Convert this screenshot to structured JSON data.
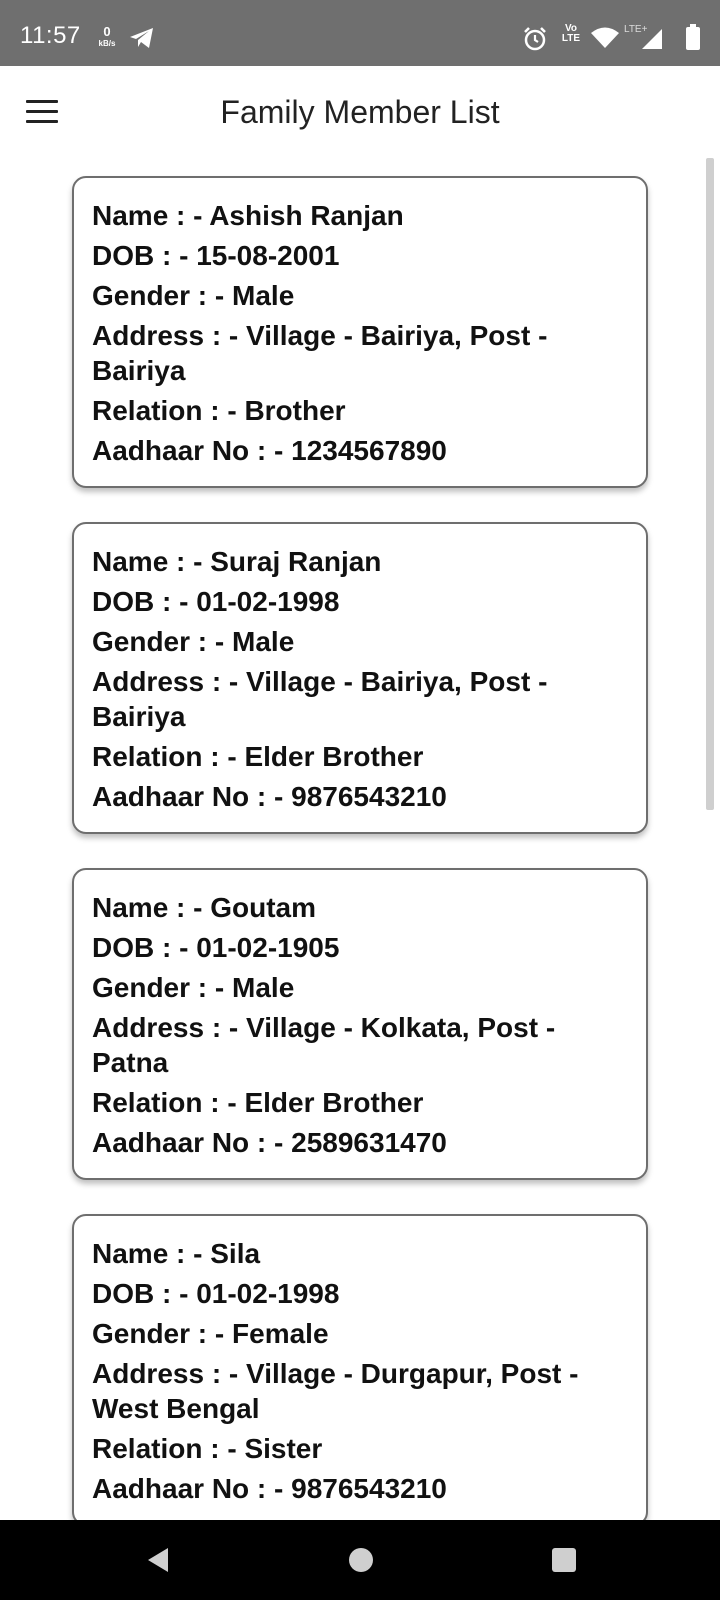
{
  "status_bar": {
    "time": "11:57",
    "speed_value": "0",
    "speed_unit": "kB/s",
    "volte_top": "Vo",
    "volte_bottom": "LTE",
    "lte_label": "LTE+",
    "icons": [
      "telegram-icon",
      "alarm-icon",
      "volte-icon",
      "wifi-icon",
      "signal-icon",
      "battery-icon"
    ]
  },
  "app_bar": {
    "title": "Family Member List",
    "menu_icon": "hamburger-menu-icon"
  },
  "members": [
    {
      "name": "Name : - Ashish Ranjan",
      "dob": "DOB : - 15-08-2001",
      "gender": "Gender : - Male",
      "address": "Address : - Village - Bairiya, Post - Bairiya",
      "relation": "Relation : - Brother",
      "aadhaar": "Aadhaar No : - 1234567890"
    },
    {
      "name": "Name : - Suraj Ranjan",
      "dob": "DOB : - 01-02-1998",
      "gender": "Gender : - Male",
      "address": "Address : - Village - Bairiya, Post - Bairiya",
      "relation": "Relation : - Elder Brother",
      "aadhaar": "Aadhaar No : - 9876543210"
    },
    {
      "name": "Name : - Goutam",
      "dob": "DOB : - 01-02-1905",
      "gender": "Gender : - Male",
      "address": "Address : - Village - Kolkata, Post - Patna",
      "relation": "Relation : - Elder Brother",
      "aadhaar": "Aadhaar No : - 2589631470"
    },
    {
      "name": "Name : - Sila",
      "dob": "DOB : - 01-02-1998",
      "gender": "Gender : - Female",
      "address": "Address : - Village - Durgapur, Post - West Bengal",
      "relation": "Relation : - Sister",
      "aadhaar": "Aadhaar No : - 9876543210"
    }
  ],
  "nav_bar": {
    "icons": [
      "back-icon",
      "home-icon",
      "recents-icon"
    ]
  },
  "colors": {
    "status_bar_bg": "#6f6f6f",
    "card_border": "#6e6e6e",
    "nav_bar_bg": "#000000"
  }
}
